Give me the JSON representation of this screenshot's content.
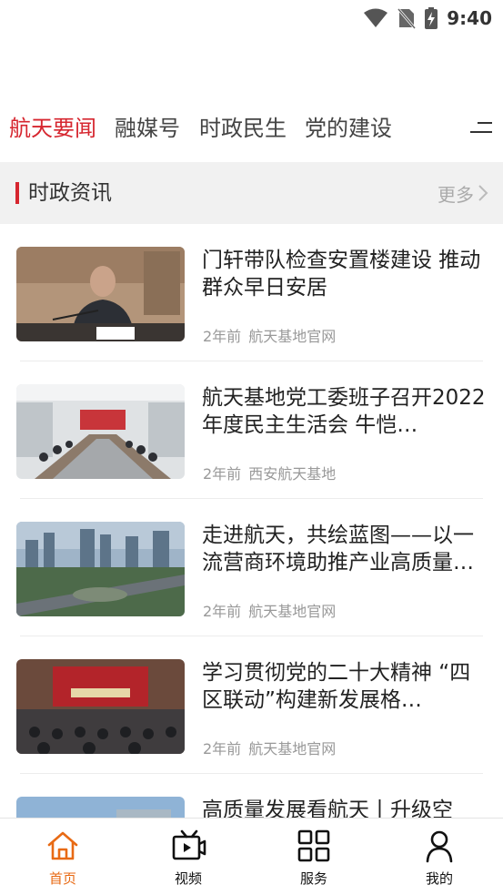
{
  "status_bar": {
    "time": "9:40",
    "icons": [
      "wifi-icon",
      "no-sim-icon",
      "battery-charging-icon"
    ]
  },
  "channel_tabs": [
    {
      "label": "航天要闻",
      "active": true
    },
    {
      "label": "融媒号",
      "active": false
    },
    {
      "label": "时政民生",
      "active": false
    },
    {
      "label": "党的建设",
      "active": false
    }
  ],
  "section": {
    "title": "时政资讯",
    "more_label": "更多"
  },
  "news": [
    {
      "title": "门轩带队检查安置楼建设  推动群众早日安居",
      "time": "2年前",
      "source": "航天基地官网",
      "thumb": "meeting-speaker"
    },
    {
      "title": "航天基地党工委班子召开2022年度民主生活会  牛恺…",
      "time": "2年前",
      "source": "西安航天基地",
      "thumb": "conference-room"
    },
    {
      "title": "走进航天，共绘蓝图——以一流营商环境助推产业高质量…",
      "time": "2年前",
      "source": "航天基地官网",
      "thumb": "city-aerial"
    },
    {
      "title": "学习贯彻党的二十大精神 “四区联动”构建新发展格…",
      "time": "2年前",
      "source": "航天基地官网",
      "thumb": "lecture-hall"
    },
    {
      "title": "高质量发展看航天丨升级空",
      "time": "",
      "source": "",
      "thumb": "building-sky"
    }
  ],
  "bottom_nav": [
    {
      "label": "首页",
      "icon": "home-icon",
      "active": true
    },
    {
      "label": "视频",
      "icon": "video-icon",
      "active": false
    },
    {
      "label": "服务",
      "icon": "grid-icon",
      "active": false
    },
    {
      "label": "我的",
      "icon": "user-icon",
      "active": false
    }
  ],
  "colors": {
    "accent_red": "#d6262f",
    "nav_active_orange": "#e86a14",
    "meta_gray": "#999999",
    "section_bg": "#f1f1f1"
  }
}
